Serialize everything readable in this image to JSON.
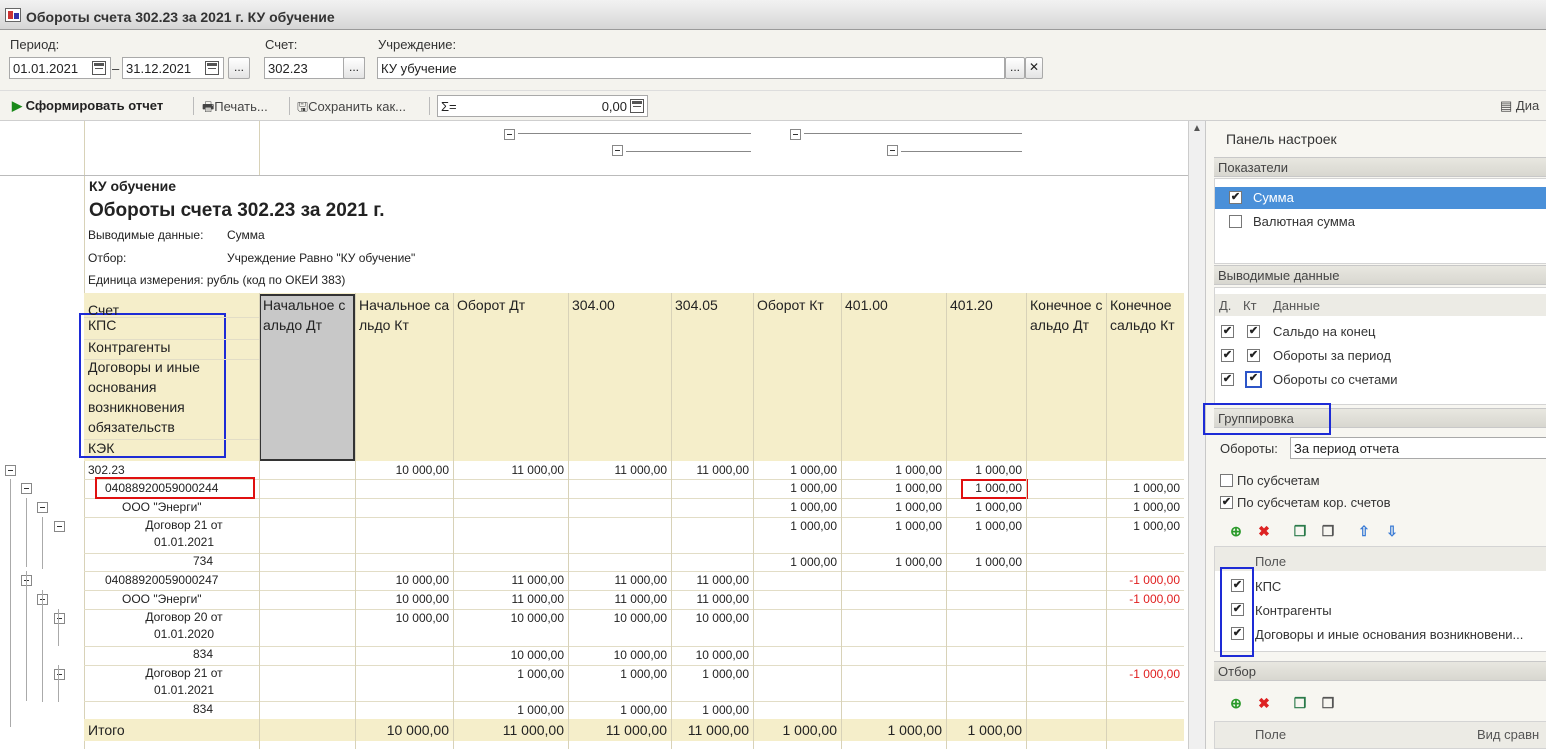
{
  "window": {
    "title": "Обороты счета 302.23 за 2021 г. КУ обучение"
  },
  "params": {
    "period_label": "Период:",
    "date_from": "01.01.2021",
    "dash": "–",
    "date_to": "31.12.2021",
    "ellipsis": "...",
    "account_label": "Счет:",
    "account": "302.23",
    "institution_label": "Учреждение:",
    "institution": "КУ убучение",
    "clear": "✕"
  },
  "toolbar": {
    "generate": "Сформировать отчет",
    "print": "Печать...",
    "save": "Сохранить как...",
    "sum_sign": "Σ=",
    "sum_value": "0,00",
    "right_btn": "Диа"
  },
  "report": {
    "org": "КУ обучение",
    "title": "Обороты счета 302.23 за 2021 г.",
    "line1_label": "Выводимые данные:",
    "line1_value": "Сумма",
    "line2_label": "Отбор:",
    "line2_value": "Учреждение Равно \"КУ обучение\"",
    "line3": "Единица измерения: рубль (код по ОКЕИ 383)",
    "group_headers": [
      "Счет",
      "КПС",
      "Контрагенты",
      "Договоры и иные основания возникновения обязательств",
      "КЭК"
    ],
    "columns": [
      "Начальное сальдо Дт",
      "Начальное сальдо Кт",
      "Оборот Дт",
      "304.00",
      "304.05",
      "Оборот Кт",
      "401.00",
      "401.20",
      "Конечное сальдо Дт",
      "Конечное сальдо Кт"
    ],
    "rows": [
      {
        "name": "302.23",
        "v": [
          "",
          "10 000,00",
          "11 000,00",
          "11 000,00",
          "11 000,00",
          "1 000,00",
          "1 000,00",
          "1 000,00",
          "",
          ""
        ]
      },
      {
        "name": "04088920059000244",
        "v": [
          "",
          "",
          "",
          "",
          "",
          "1 000,00",
          "1 000,00",
          "1 000,00",
          "",
          "1 000,00"
        ]
      },
      {
        "name": "ООО \"Энерги\"",
        "v": [
          "",
          "",
          "",
          "",
          "",
          "1 000,00",
          "1 000,00",
          "1 000,00",
          "",
          "1 000,00"
        ]
      },
      {
        "name": "Договор 21 от 01.01.2021",
        "v": [
          "",
          "",
          "",
          "",
          "",
          "1 000,00",
          "1 000,00",
          "1 000,00",
          "",
          "1 000,00"
        ]
      },
      {
        "name": "734",
        "v": [
          "",
          "",
          "",
          "",
          "",
          "1 000,00",
          "1 000,00",
          "1 000,00",
          "",
          ""
        ]
      },
      {
        "name": "04088920059000247",
        "v": [
          "",
          "10 000,00",
          "11 000,00",
          "11 000,00",
          "11 000,00",
          "",
          "",
          "",
          "",
          "-1 000,00"
        ]
      },
      {
        "name": "ООО \"Энерги\"",
        "v": [
          "",
          "10 000,00",
          "11 000,00",
          "11 000,00",
          "11 000,00",
          "",
          "",
          "",
          "",
          "-1 000,00"
        ]
      },
      {
        "name": "Договор 20 от 01.01.2020",
        "v": [
          "",
          "10 000,00",
          "10 000,00",
          "10 000,00",
          "10 000,00",
          "",
          "",
          "",
          "",
          ""
        ]
      },
      {
        "name": "834",
        "v": [
          "",
          "",
          "10 000,00",
          "10 000,00",
          "10 000,00",
          "",
          "",
          "",
          "",
          ""
        ]
      },
      {
        "name": "Договор 21 от 01.01.2021",
        "v": [
          "",
          "",
          "1 000,00",
          "1 000,00",
          "1 000,00",
          "",
          "",
          "",
          "",
          "-1 000,00"
        ]
      },
      {
        "name": "834",
        "v": [
          "",
          "",
          "1 000,00",
          "1 000,00",
          "1 000,00",
          "",
          "",
          "",
          "",
          ""
        ]
      }
    ],
    "total": {
      "name": "Итого",
      "v": [
        "",
        "10 000,00",
        "11 000,00",
        "11 000,00",
        "11 000,00",
        "1 000,00",
        "1 000,00",
        "1 000,00",
        "",
        ""
      ]
    }
  },
  "panel": {
    "title": "Панель настроек",
    "indicators_title": "Показатели",
    "indicators": [
      {
        "label": "Сумма",
        "checked": true
      },
      {
        "label": "Валютная сумма",
        "checked": false
      }
    ],
    "output_title": "Выводимые данные",
    "output_header": {
      "d": "Д.",
      "k": "Кт",
      "data": "Данные"
    },
    "output": [
      "Сальдо на конец",
      "Обороты за период",
      "Обороты со счетами"
    ],
    "grouping_title": "Группировка",
    "turnover_label": "Обороты:",
    "turnover_value": "За период отчета",
    "by_subaccounts": "По субсчетам",
    "by_corr_subaccounts": "По субсчетам кор. счетов",
    "field_header": "Поле",
    "fields": [
      "КПС",
      "Контрагенты",
      "Договоры и иные основания возникновени..."
    ],
    "filter_title": "Отбор",
    "filter_field_header": "Поле",
    "filter_compare_header": "Вид сравн"
  },
  "colors": {
    "header_bg": "#f5eeca",
    "accent_blue": "#1d2bd6",
    "accent_red": "#e01010",
    "negative": "#e02020"
  }
}
